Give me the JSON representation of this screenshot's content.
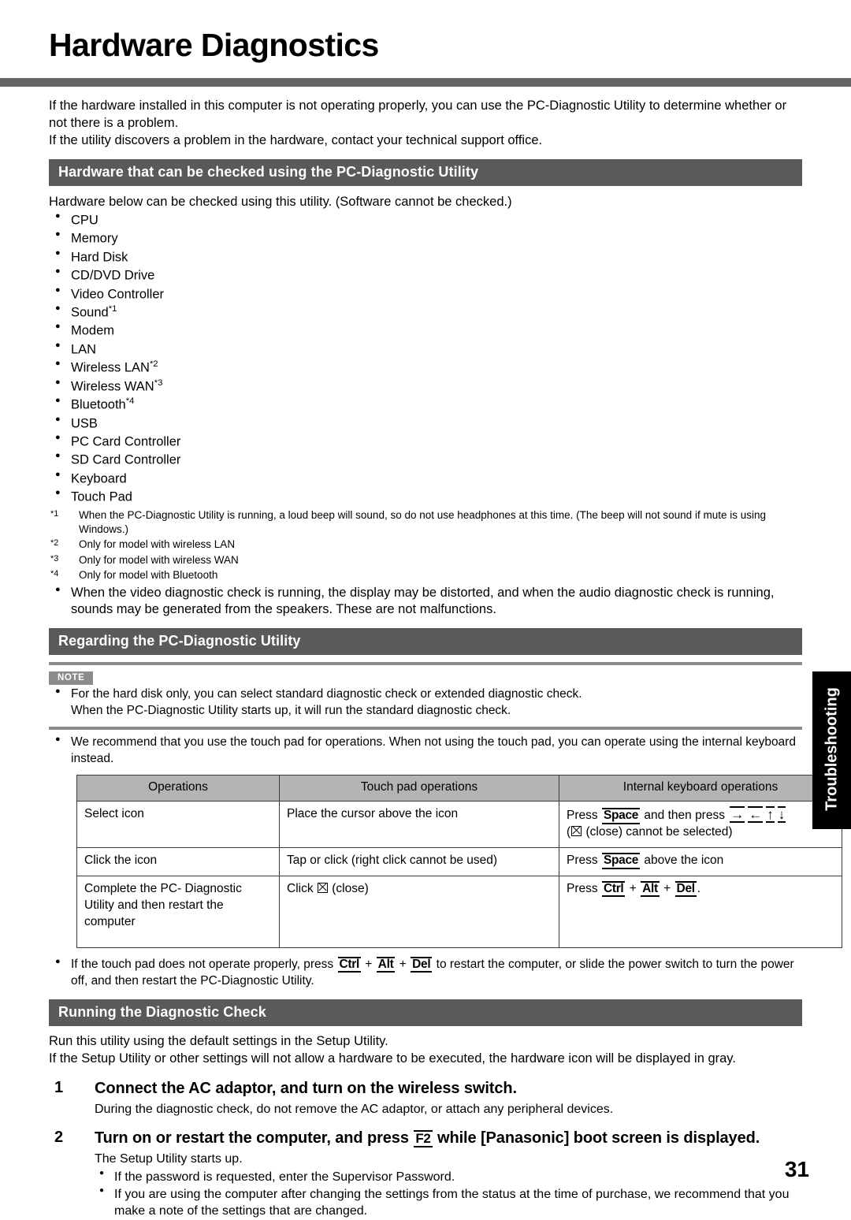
{
  "page": {
    "title": "Hardware Diagnostics",
    "number": "31",
    "side_tab": "Troubleshooting",
    "accent_bar_color": "#666666",
    "section_bar_color": "#5a5a5a",
    "note_badge_color": "#8c8c8c",
    "table_header_color": "#b4b4b4"
  },
  "intro": {
    "line1": "If the hardware installed in this computer is not operating properly, you can use the PC-Diagnostic Utility to determine whether or not there is a problem.",
    "line2": "If the utility discovers a problem in the hardware, contact your technical support office."
  },
  "section_hardware": {
    "heading": "Hardware that can be checked using the PC-Diagnostic Utility",
    "lead": "Hardware below can be checked using this utility. (Software cannot be checked.)",
    "items": [
      {
        "label": "CPU",
        "note": ""
      },
      {
        "label": "Memory",
        "note": ""
      },
      {
        "label": "Hard Disk",
        "note": ""
      },
      {
        "label": "CD/DVD Drive",
        "note": ""
      },
      {
        "label": "Video Controller",
        "note": ""
      },
      {
        "label": "Sound",
        "note": "*1"
      },
      {
        "label": "Modem",
        "note": ""
      },
      {
        "label": "LAN",
        "note": ""
      },
      {
        "label": "Wireless LAN",
        "note": "*2"
      },
      {
        "label": "Wireless WAN",
        "note": "*3"
      },
      {
        "label": "Bluetooth",
        "note": "*4"
      },
      {
        "label": "USB",
        "note": ""
      },
      {
        "label": "PC Card Controller",
        "note": ""
      },
      {
        "label": "SD Card Controller",
        "note": ""
      },
      {
        "label": "Keyboard",
        "note": ""
      },
      {
        "label": "Touch Pad",
        "note": ""
      }
    ],
    "footnotes": [
      {
        "mark": "*1",
        "text": "When the PC-Diagnostic Utility is running, a loud beep will sound, so do not use headphones at this time. (The beep will not sound if mute is using Windows.)"
      },
      {
        "mark": "*2",
        "text": "Only for model with wireless LAN"
      },
      {
        "mark": "*3",
        "text": "Only for model with wireless WAN"
      },
      {
        "mark": "*4",
        "text": "Only for model with Bluetooth"
      }
    ],
    "closing_bullet": "When the video diagnostic check is running, the display may be distorted, and when the audio diagnostic check is running, sounds may be generated from the speakers. These are not malfunctions."
  },
  "section_regarding": {
    "heading": "Regarding the PC-Diagnostic Utility",
    "note_badge": "NOTE",
    "note_bullet_1_line1": "For the hard disk only, you can select standard diagnostic check or extended diagnostic check.",
    "note_bullet_1_line2": "When the PC-Diagnostic Utility starts up, it will run the standard diagnostic check.",
    "note_bullet_2": "We recommend that you use the touch pad for operations. When not using the touch pad, you can operate using the internal keyboard instead.",
    "table": {
      "headers": [
        "Operations",
        "Touch pad operations",
        "Internal keyboard operations"
      ],
      "rows": [
        {
          "operation": "Select icon",
          "touchpad": "Place the cursor above the icon",
          "keyboard_pre": "Press",
          "keyboard_key": "Space",
          "keyboard_mid": "and then press",
          "keyboard_arrows": [
            "→",
            "←",
            "↑",
            "↓"
          ],
          "keyboard_post_open": "(",
          "keyboard_post_text": "(close) cannot be selected)"
        },
        {
          "operation": "Click the icon",
          "touchpad": "Tap or click (right click cannot be used)",
          "keyboard_pre": "Press",
          "keyboard_key": "Space",
          "keyboard_mid": "above the icon"
        },
        {
          "operation": "Complete the PC- Diagnostic Utility and then restart the computer",
          "touchpad_pre": "Click",
          "touchpad_post": "(close)",
          "keyboard_pre": "Press",
          "keys": [
            "Ctrl",
            "Alt",
            "Del"
          ],
          "keyboard_post": "."
        }
      ]
    },
    "touchpad_fail_bullet": {
      "pre": "If the touch pad does not operate properly, press",
      "keys": [
        "Ctrl",
        "Alt",
        "Del"
      ],
      "post": "to restart the computer, or slide the power switch to turn the power off, and then restart the PC-Diagnostic Utility."
    }
  },
  "section_running": {
    "heading": "Running the Diagnostic Check",
    "lead1": "Run this utility using the default settings in the Setup Utility.",
    "lead2": "If the Setup Utility or other settings will not allow a hardware to be executed, the hardware icon will be displayed in gray.",
    "steps": [
      {
        "num": "1",
        "title": "Connect the AC adaptor, and turn on the wireless switch.",
        "body": "During the diagnostic check, do not remove the AC adaptor, or attach any peripheral devices.",
        "substeps": []
      },
      {
        "num": "2",
        "title_pre": "Turn on or restart the computer, and press",
        "title_key": "F2",
        "title_post": "while [Panasonic] boot screen is displayed.",
        "num_label": "2",
        "body": "The Setup Utility starts up.",
        "substeps": [
          "If the password is requested, enter the Supervisor Password.",
          "If you are using the computer after changing the settings from the status at the time of purchase, we recommend that you make a note of the settings that are changed."
        ]
      }
    ]
  }
}
